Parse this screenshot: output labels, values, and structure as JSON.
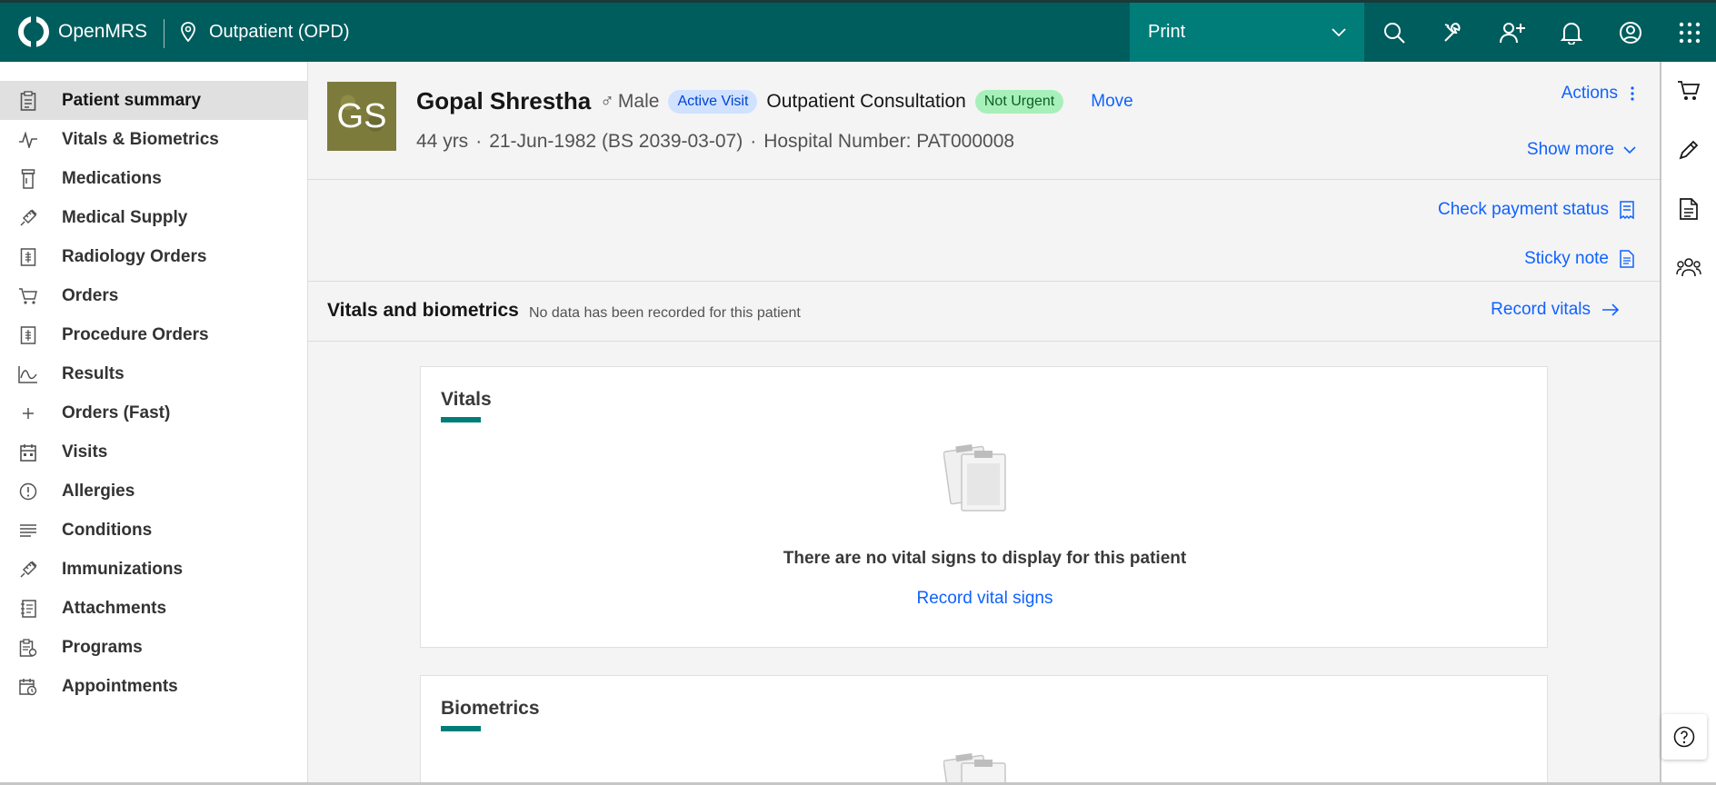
{
  "header": {
    "app_name": "OpenMRS",
    "location": "Outpatient (OPD)",
    "print_label": "Print",
    "icons": [
      "search-icon",
      "tools-icon",
      "add-patient-icon",
      "bell-icon",
      "user-avatar-icon",
      "app-switcher-icon"
    ]
  },
  "nav": {
    "items": [
      {
        "label": "Patient summary",
        "icon": "clipboard-icon",
        "active": true
      },
      {
        "label": "Vitals & Biometrics",
        "icon": "activity-icon"
      },
      {
        "label": "Medications",
        "icon": "pill-bottle-icon"
      },
      {
        "label": "Medical Supply",
        "icon": "syringe-icon"
      },
      {
        "label": "Radiology Orders",
        "icon": "ledger-icon"
      },
      {
        "label": "Orders",
        "icon": "cart-icon"
      },
      {
        "label": "Procedure Orders",
        "icon": "ledger-icon"
      },
      {
        "label": "Results",
        "icon": "chart-icon"
      },
      {
        "label": "Orders (Fast)",
        "icon": "plus-icon"
      },
      {
        "label": "Visits",
        "icon": "calendar-icon"
      },
      {
        "label": "Allergies",
        "icon": "warning-circle-icon"
      },
      {
        "label": "Conditions",
        "icon": "list-icon"
      },
      {
        "label": "Immunizations",
        "icon": "syringe-icon"
      },
      {
        "label": "Attachments",
        "icon": "attachment-icon"
      },
      {
        "label": "Programs",
        "icon": "report-icon"
      },
      {
        "label": "Appointments",
        "icon": "calendar-clock-icon"
      }
    ]
  },
  "patient": {
    "initials": "GS",
    "name": "Gopal Shrestha",
    "gender_symbol": "♂",
    "gender": "Male",
    "visit_tag": "Active Visit",
    "visit_type": "Outpatient Consultation",
    "priority_tag": "Not Urgent",
    "move_label": "Move",
    "age": "44 yrs",
    "dob": "21-Jun-1982 (BS 2039-03-07)",
    "hospital_number": "Hospital Number: PAT000008",
    "actions_label": "Actions",
    "show_more_label": "Show more"
  },
  "banner_links": {
    "payment": "Check payment status",
    "sticky": "Sticky note"
  },
  "vitals_section": {
    "title": "Vitals and biometrics",
    "subtitle": "No data has been recorded for this patient",
    "record_label": "Record vitals"
  },
  "vitals_card": {
    "title": "Vitals",
    "empty_text": "There are no vital signs to display for this patient",
    "link": "Record vital signs"
  },
  "biometrics_card": {
    "title": "Biometrics"
  },
  "colors": {
    "header_bg": "#005d5d",
    "print_bg": "#007d79",
    "link": "#0f62fe",
    "accent": "#007d79"
  }
}
